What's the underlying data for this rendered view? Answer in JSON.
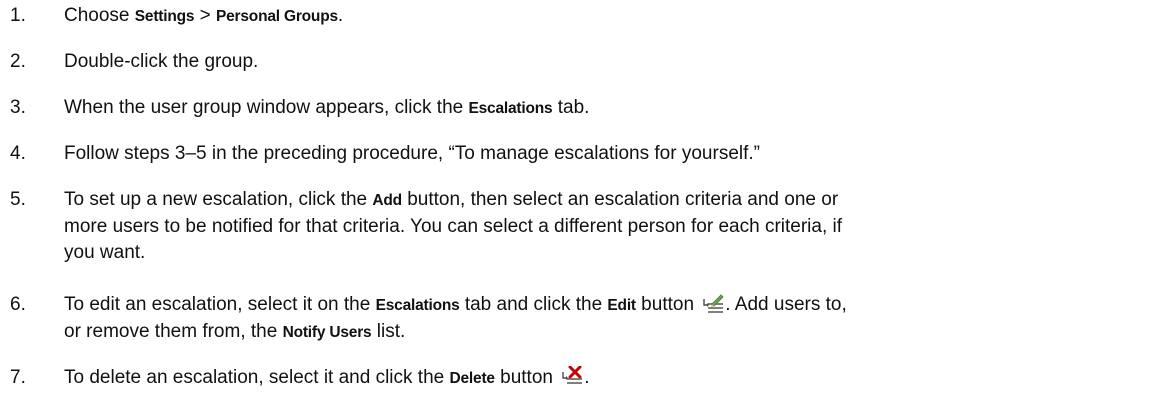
{
  "steps": [
    {
      "number": "1.",
      "t1": "Choose ",
      "b1": "Settings",
      "t2": " > ",
      "b2": "Personal Groups",
      "t3": "."
    },
    {
      "number": "2.",
      "t1": "Double-click the group."
    },
    {
      "number": "3.",
      "t1": "When the user group window appears, click the ",
      "b1": "Escalations",
      "t2": " tab."
    },
    {
      "number": "4.",
      "t1": "Follow steps 3–5 in the preceding procedure, “To manage escalations for yourself.”"
    },
    {
      "number": "5.",
      "t1": "To set up a new escalation, click the ",
      "b1": "Add",
      "t2": " button, then select an escalation criteria and one or",
      "line2": "more users to be notified for that criteria. You can select a different person for each criteria, if",
      "line3": "you want."
    },
    {
      "number": "6.",
      "t1": "To edit an escalation, select it on the ",
      "b1": "Escalations",
      "t2": " tab and click the ",
      "b2": "Edit",
      "t3": " button ",
      "t4": ". Add users to,",
      "line2a": "or remove them from, the ",
      "line2b": "Notify Users",
      "line2c": " list."
    },
    {
      "number": "7.",
      "t1": "To delete an escalation, select it and click the ",
      "b1": "Delete",
      "t2": " button ",
      "t3": "."
    }
  ],
  "icons": {
    "edit": "edit-escalation-icon",
    "delete": "delete-escalation-icon"
  },
  "colors": {
    "text": "#111111",
    "icon_pencil": "#6aa84f",
    "icon_lines": "#7f7f7f",
    "icon_x": "#cc0000"
  }
}
